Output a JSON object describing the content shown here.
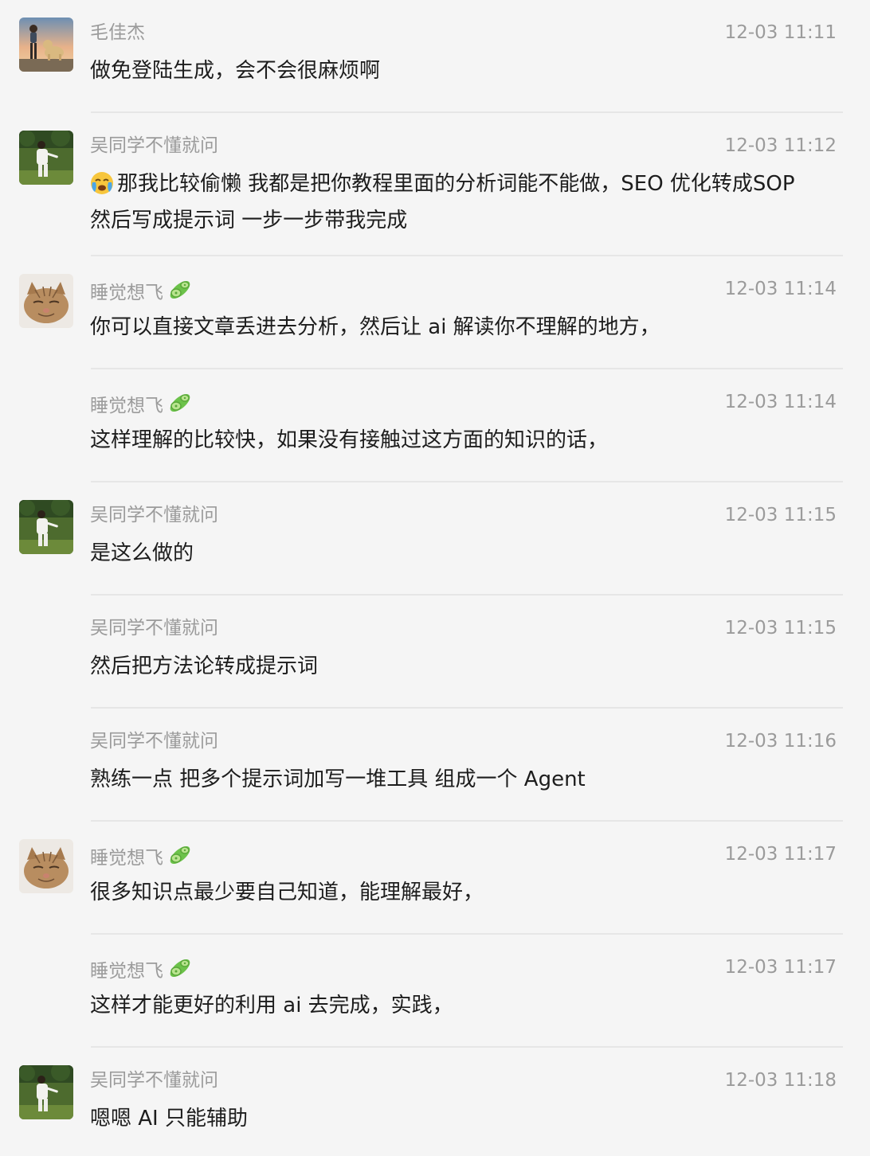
{
  "colors": {
    "background": "#f5f5f5",
    "meta_text": "#9b9b9b",
    "body_text": "#1d1d1d",
    "divider": "#e6e6e6",
    "cucumber_badge": "#6cc24a"
  },
  "messages": [
    {
      "sender": "毛佳杰",
      "time": "12-03 11:11",
      "text": "做免登陆生成，会不会很麻烦啊",
      "avatar": "boy-with-dog-sunset"
    },
    {
      "sender": "吴同学不懂就问",
      "time": "12-03 11:12",
      "emoji": "crying-face-emoji",
      "text": "那我比较偷懒  我都是把你教程里面的分析词能不能做，SEO 优化转成SOP 然后写成提示词 一步一步带我完成",
      "avatar": "person-in-garden"
    },
    {
      "sender": "睡觉想飞",
      "badge": "cucumber-icon",
      "time": "12-03 11:14",
      "text": "你可以直接文章丢进去分析，然后让 ai 解读你不理解的地方，",
      "avatar": "sleeping-cat"
    },
    {
      "sender": "睡觉想飞",
      "badge": "cucumber-icon",
      "time": "12-03 11:14",
      "text": "这样理解的比较快，如果没有接触过这方面的知识的话，"
    },
    {
      "sender": "吴同学不懂就问",
      "time": "12-03 11:15",
      "text": "是这么做的",
      "avatar": "person-in-garden"
    },
    {
      "sender": "吴同学不懂就问",
      "time": "12-03 11:15",
      "text": "然后把方法论转成提示词"
    },
    {
      "sender": "吴同学不懂就问",
      "time": "12-03 11:16",
      "text": "熟练一点  把多个提示词加写一堆工具 组成一个 Agent"
    },
    {
      "sender": "睡觉想飞",
      "badge": "cucumber-icon",
      "time": "12-03 11:17",
      "text": "很多知识点最少要自己知道，能理解最好，",
      "avatar": "sleeping-cat"
    },
    {
      "sender": "睡觉想飞",
      "badge": "cucumber-icon",
      "time": "12-03 11:17",
      "text": "这样才能更好的利用 ai 去完成，实践，"
    },
    {
      "sender": "吴同学不懂就问",
      "time": "12-03 11:18",
      "text": "嗯嗯  AI 只能辅助",
      "avatar": "person-in-garden"
    }
  ]
}
